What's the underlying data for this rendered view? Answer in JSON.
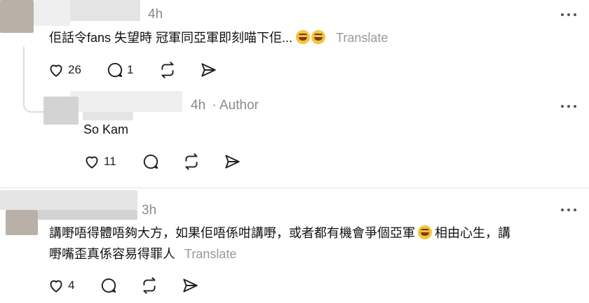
{
  "comments": [
    {
      "time": "4h",
      "text": "佢話令fans 失望時 冠軍同亞軍即刻喵下佢...",
      "translate": "Translate",
      "likes": "26",
      "replies": "1"
    },
    {
      "time": "4h",
      "author_tag": "· Author",
      "text": "So Kam",
      "likes": "11"
    },
    {
      "time": "3h",
      "text_line1": "講嘢唔得體唔夠大方，如果佢唔係咁講嘢，或者都有機會爭個亞軍",
      "text_line1b": "相由心生，講",
      "text_line2": "嘢嘴歪真係容易得罪人",
      "translate": "Translate",
      "likes": "4"
    }
  ],
  "icons": {
    "like": "heart-icon",
    "reply": "comment-icon",
    "repost": "repost-icon",
    "share": "send-icon",
    "more": "more-dots-icon",
    "emoji": "rolling-laughing-emoji"
  }
}
